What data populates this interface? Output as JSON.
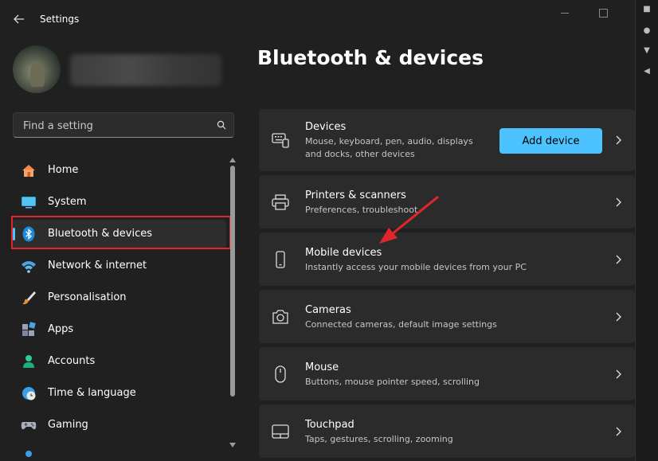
{
  "window": {
    "title": "Settings"
  },
  "sidebar": {
    "search_placeholder": "Find a setting",
    "items": [
      {
        "label": "Home",
        "icon": "home-icon"
      },
      {
        "label": "System",
        "icon": "monitor-icon"
      },
      {
        "label": "Bluetooth & devices",
        "icon": "bluetooth-icon",
        "selected": true
      },
      {
        "label": "Network & internet",
        "icon": "wifi-icon"
      },
      {
        "label": "Personalisation",
        "icon": "brush-icon"
      },
      {
        "label": "Apps",
        "icon": "apps-icon"
      },
      {
        "label": "Accounts",
        "icon": "person-icon"
      },
      {
        "label": "Time & language",
        "icon": "clock-globe-icon"
      },
      {
        "label": "Gaming",
        "icon": "gamepad-icon"
      }
    ]
  },
  "main": {
    "title": "Bluetooth & devices",
    "cards": [
      {
        "title": "Devices",
        "subtitle_line1": "Mouse, keyboard, pen, audio, displays",
        "subtitle_line2": "and docks, other devices",
        "button": "Add device",
        "icon": "devices-icon"
      },
      {
        "title": "Printers & scanners",
        "subtitle": "Preferences, troubleshoot",
        "icon": "printer-icon"
      },
      {
        "title": "Mobile devices",
        "subtitle": "Instantly access your mobile devices from your PC",
        "icon": "phone-icon"
      },
      {
        "title": "Cameras",
        "subtitle": "Connected cameras, default image settings",
        "icon": "camera-icon"
      },
      {
        "title": "Mouse",
        "subtitle": "Buttons, mouse pointer speed, scrolling",
        "icon": "mouse-icon"
      },
      {
        "title": "Touchpad",
        "subtitle": "Taps, gestures, scrolling, zooming",
        "icon": "touchpad-icon"
      }
    ]
  },
  "colors": {
    "accent": "#4cc2ff",
    "highlight": "#e0262b",
    "background": "#202020",
    "card": "#2b2b2b"
  }
}
